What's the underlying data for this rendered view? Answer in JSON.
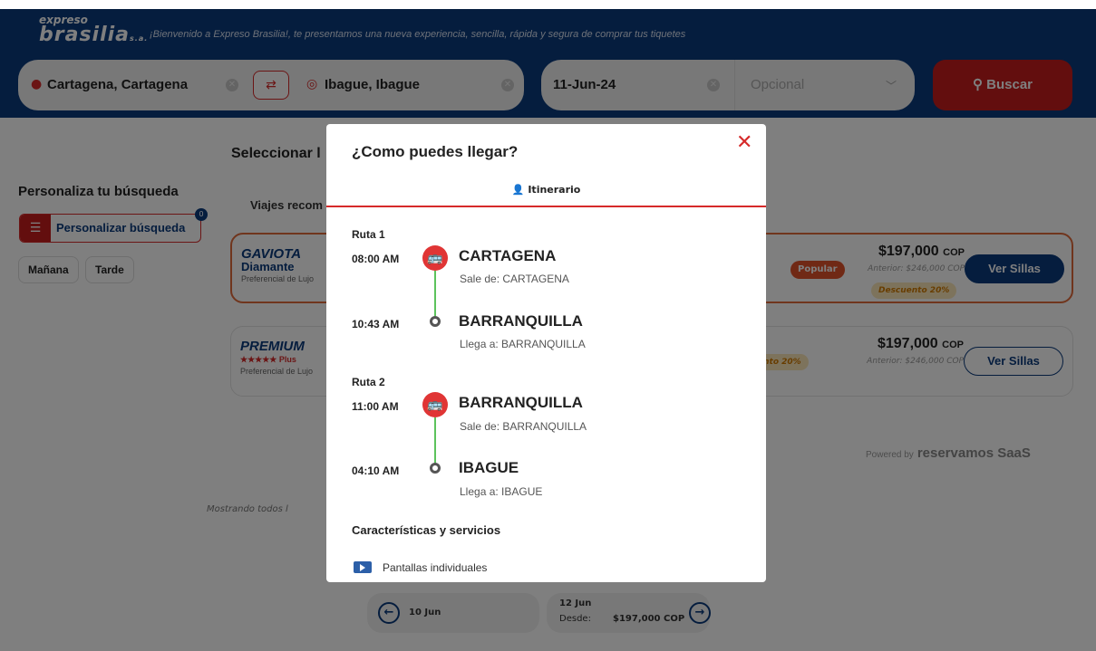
{
  "colors": {
    "brand_blue": "#0b3a7c",
    "accent_red": "#d62a2a",
    "route_green": "#5cc35c"
  },
  "header": {
    "logo_line1": "expreso",
    "logo_line2": "brasilia",
    "logo_suffix": "s.a.",
    "welcome": "¡Bienvenido a Expreso Brasilia!, te presentamos una nueva experiencia, sencilla, rápida y segura de comprar tus tiquetes",
    "origin": "Cartagena, Cartagena",
    "destination": "Ibague, Ibague",
    "date": "11-Jun-24",
    "return_placeholder": "Opcional",
    "search_label": "Buscar"
  },
  "sidebar": {
    "title": "Personaliza tu búsqueda",
    "customize_label": "Personalizar búsqueda",
    "customize_count": "0",
    "chips": [
      "Mañana",
      "Tarde"
    ]
  },
  "results": {
    "title": "Seleccionar l",
    "recommended": "Viajes recom",
    "trips": [
      {
        "brand_name": "GAVIOTA",
        "brand_sub": "Diamante",
        "service": "Preferencial de Lujo",
        "tag": "Popular",
        "price": "$197,000",
        "currency": "COP",
        "previous": "Anterior: $246,000 COP",
        "discount": "Descuento 20%",
        "action": "Ver Sillas"
      },
      {
        "brand_name": "PREMIUM",
        "brand_sub": "★★★★★ Plus",
        "service": "Preferencial de Lujo",
        "discount": "ento 20%",
        "price": "$197,000",
        "currency": "COP",
        "previous": "Anterior: $246,000 COP",
        "action": "Ver Sillas"
      }
    ],
    "powered_by": "Powered by",
    "powered_brand": "reservamos SaaS",
    "showing": "Mostrando todos l"
  },
  "date_nav": {
    "prev_date": "10 Jun",
    "next_date": "12 Jun",
    "next_from_label": "Desde:",
    "next_price": "$197,000 COP"
  },
  "modal": {
    "title": "¿Como puedes llegar?",
    "tab_label": "Itinerario",
    "routes": [
      {
        "label": "Ruta 1",
        "depart_time": "08:00 AM",
        "depart_city": "CARTAGENA",
        "depart_sub": "Sale de: CARTAGENA",
        "arrive_time": "10:43 AM",
        "arrive_city": "BARRANQUILLA",
        "arrive_sub": "Llega a: BARRANQUILLA"
      },
      {
        "label": "Ruta 2",
        "depart_time": "11:00 AM",
        "depart_city": "BARRANQUILLA",
        "depart_sub": "Sale de: BARRANQUILLA",
        "arrive_time": "04:10 AM",
        "arrive_city": "IBAGUE",
        "arrive_sub": "Llega a: IBAGUE"
      }
    ],
    "features_title": "Características y servicios",
    "features": [
      "Pantallas individuales"
    ]
  }
}
